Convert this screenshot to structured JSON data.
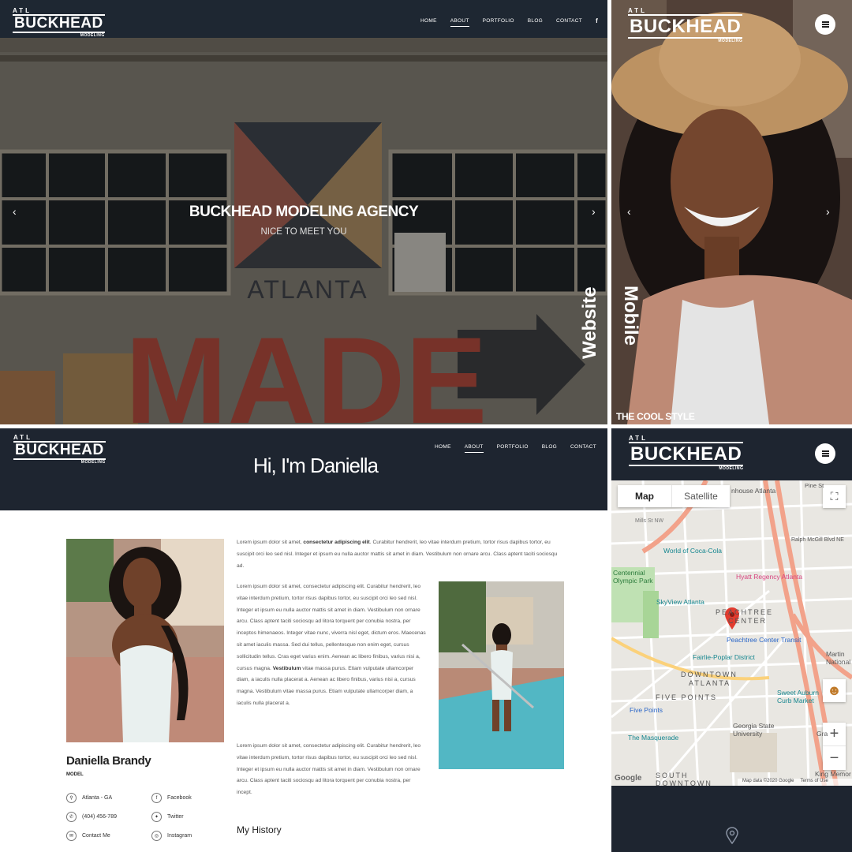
{
  "colors": {
    "navy": "#1e2530",
    "mapbg": "#e9e7e2",
    "road": "#f2a28a",
    "pin": "#e23b2e",
    "water": "#7fd0de"
  },
  "hero": {
    "logo": {
      "top": "ATL",
      "main": "BUCKHEAD",
      "sub": "MODELING"
    },
    "nav": [
      "HOME",
      "ABOUT",
      "PORTFOLIO",
      "BLOG",
      "CONTACT"
    ],
    "social": {
      "facebook": "f",
      "instagram": "◎"
    },
    "title": "BUCKHEAD MODELING AGENCY",
    "subtitle": "NICE TO MEET YOU",
    "prev": "‹",
    "next": "›",
    "mural": {
      "line1": "ATLANTA",
      "line2": "MADE"
    },
    "side_label": "Website"
  },
  "mobile": {
    "logo": {
      "top": "ATL",
      "main": "BUCKHEAD",
      "sub": "MODELING"
    },
    "caption": "THE COOL STYLE",
    "side_label": "Mobile",
    "prev": "‹",
    "next": "›"
  },
  "about": {
    "logo": {
      "top": "ATL",
      "main": "BUCKHEAD",
      "sub": "MODELING"
    },
    "nav": [
      "HOME",
      "ABOUT",
      "PORTFOLIO",
      "BLOG",
      "CONTACT"
    ],
    "social": "f",
    "heading": "Hi, I'm Daniella",
    "name": "Daniella Brandy",
    "role": "MODEL",
    "contacts": [
      {
        "icon": "⚲",
        "label": "Atlanta - GA"
      },
      {
        "icon": "✆",
        "label": "(404) 456-789"
      },
      {
        "icon": "✉",
        "label": "Contact Me"
      }
    ],
    "socials": [
      {
        "icon": "f",
        "label": "Facebook"
      },
      {
        "icon": "✦",
        "label": "Twitter"
      },
      {
        "icon": "◎",
        "label": "Instagram"
      }
    ],
    "p1_a": "Lorem ipsum dolor sit amet, ",
    "p1_b": "consectetur adipiscing elit",
    "p1_c": ". Curabitur hendrerit, leo vitae interdum pretium, tortor risus dapibus tortor, eu suscipit orci leo sed nisl. Integer et ipsum eu nulla auctor mattis sit amet in diam. Vestibulum non ornare arcu. Class aptent taciti sociosqu ad.",
    "p2_a": "Lorem ipsum dolor sit amet, consectetur adipiscing elit. Curabitur hendrerit, leo vitae interdum pretium, tortor risus dapibus tortor, eu suscipit orci leo sed nisl. Integer et ipsum eu nulla auctor mattis sit amet in diam. Vestibulum non ornare arcu. Class aptent taciti sociosqu ad litora torquent per conubia nostra, per inceptos himenaeos. Integer vitae nunc, viverra nisl eget, dictum eros. Maecenas sit amet iaculis massa. Sed dui tellus, pellentesque non enim eget, cursus sollicitudin tellus. Cras eget varius enim. Aenean ac libero finibus, varius nisi a, cursus magna. ",
    "p2_b": "Vestibulum",
    "p2_c": " vitae massa purus. Etiam vulputate ullamcorper diam, a iaculis nulla placerat a. Aenean ac libero finibus, varius nisi a, cursus magna. Vestibulum vitae massa purus. Etiam vulputate ullamcorper diam, a iaculis nulla placerat a.",
    "p3": "Lorem ipsum dolor sit amet, consectetur adipiscing elit. Curabitur hendrerit, leo vitae interdum pretium, tortor risus dapibus tortor, eu suscipit orci leo sed nisl. Integer et ipsum eu nulla auctor mattis sit amet in diam. Vestibulum non ornare arcu. Class aptent taciti sociosqu ad litora torquent per conubia nostra, per incept.",
    "history": "My History"
  },
  "map": {
    "logo": {
      "top": "ATL",
      "main": "BUCKHEAD",
      "sub": "MODELING"
    },
    "tab_map": "Map",
    "tab_sat": "Satellite",
    "zoom_in": "+",
    "zoom_out": "−",
    "attribution": "Map data ©2020 Google",
    "terms": "Terms of Use",
    "google": "Google",
    "pin_icon": "location-pin-icon",
    "labels": {
      "hotel": "nhouse Atlanta",
      "pine": "Pine St",
      "mills": "Mills St NW",
      "ralph": "Ralph McGill Blvd NE",
      "coke": "World of Coca-Cola",
      "centennial": "Centennial\nOlympic Park",
      "hyatt": "Hyatt Regency Atlanta",
      "skyview": "SkyView Atlanta",
      "peach1": "PEACHTREE",
      "peach2": "CENTER",
      "transit": "Peachtree Center Transit",
      "fairlie": "Fairlie-Poplar District",
      "martin": "Martin\nNational",
      "down1": "DOWNTOWN",
      "down2": "ATLANTA",
      "five": "FIVE POINTS",
      "sweet": "Sweet Auburn\nCurb Market",
      "fivepoints": "Five Points",
      "gsu": "Georgia State\nUniversity",
      "masq": "The Masquerade",
      "gra": "Gra",
      "south": "SOUTH\nDOWNTOWN",
      "king": "King Memor"
    }
  }
}
